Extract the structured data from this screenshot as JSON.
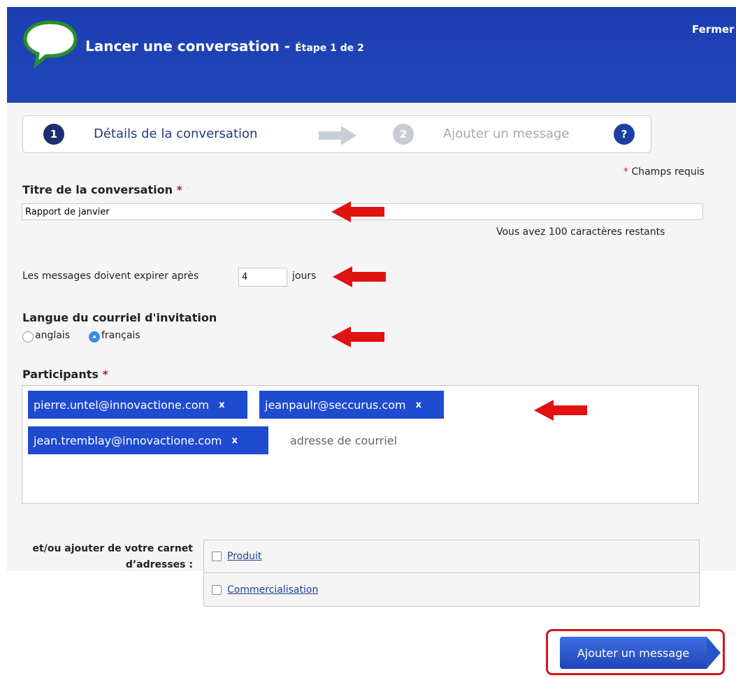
{
  "header": {
    "title": "Lancer une conversation",
    "separator": " - ",
    "step": "Étape 1 de 2",
    "close": "Fermer"
  },
  "stepper": {
    "steps": [
      {
        "number": "1",
        "label": "Détails de la conversation",
        "state": "active"
      },
      {
        "number": "2",
        "label": "Ajouter un message",
        "state": "inactive"
      }
    ],
    "help": "?"
  },
  "form": {
    "required_note": "Champs requis",
    "required_marker": "*",
    "title_label": "Titre de la conversation",
    "title_value": "Rapport de janvier",
    "chars_remaining": "Vous avez 100 caractères restants",
    "expire_before": "Les messages doivent expirer après",
    "expire_value": "4",
    "expire_after": "jours",
    "language_label": "Langue du courriel d'invitation",
    "language_options": [
      {
        "label": "anglais",
        "selected": false
      },
      {
        "label": "français",
        "selected": true
      }
    ],
    "participants_label": "Participants",
    "participants": [
      {
        "email": "pierre.untel@innovactione.com",
        "remove": "x"
      },
      {
        "email": "jeanpaulr@seccurus.com",
        "remove": "x"
      },
      {
        "email": "jean.tremblay@innovactione.com",
        "remove": "x"
      }
    ],
    "email_placeholder": "adresse de courriel",
    "addressbook_label": "et/ou ajouter de votre carnet d’adresses :",
    "addressbook_items": [
      {
        "label": "Produit",
        "checked": false
      },
      {
        "label": "Commercialisation",
        "checked": false
      }
    ]
  },
  "actions": {
    "submit": "Ajouter un message"
  },
  "colors": {
    "header": "#2046b8",
    "chip": "#1f4bd0",
    "annotation": "#d51515",
    "required": "#d21a1a"
  }
}
